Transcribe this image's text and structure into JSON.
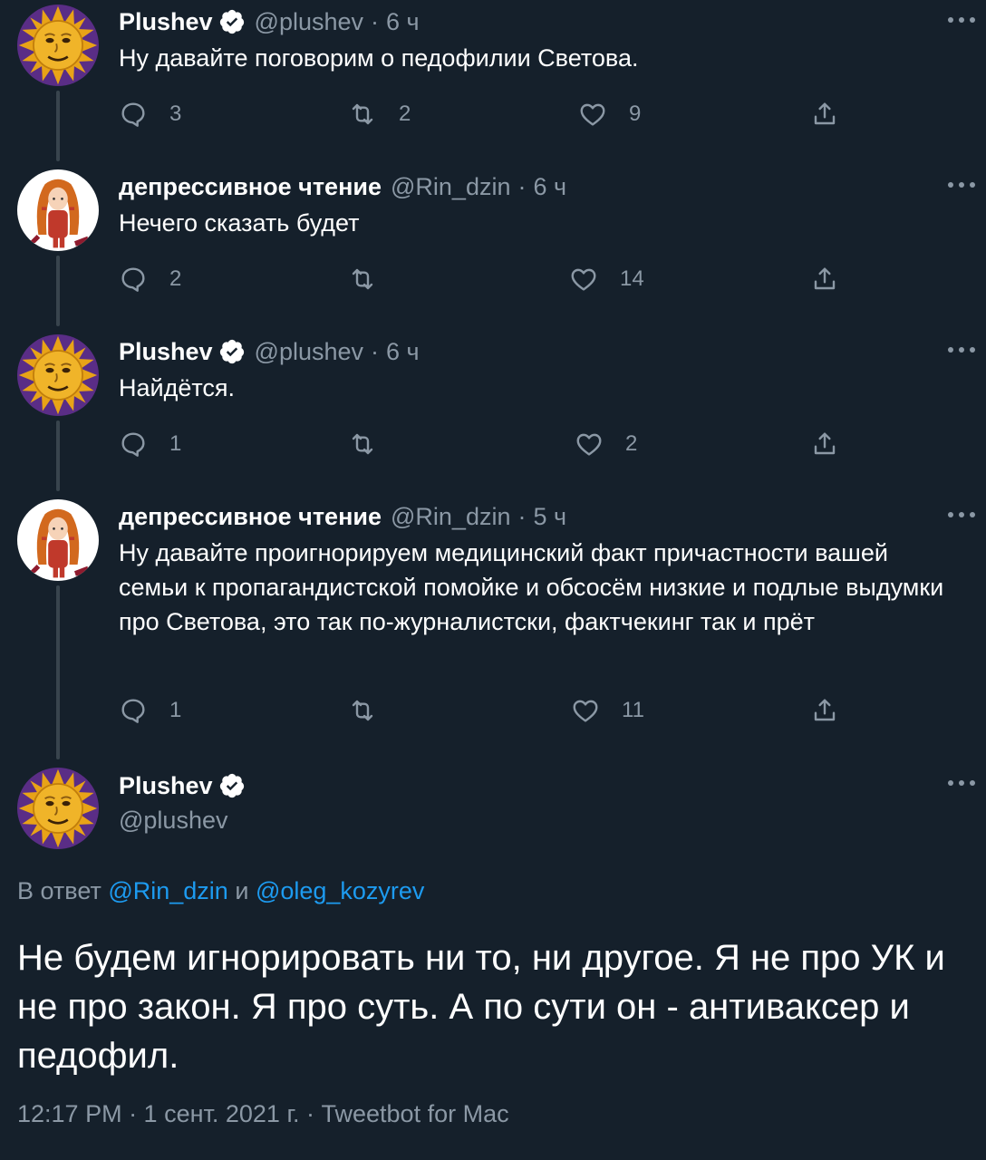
{
  "theme": {
    "background": "#15202b",
    "secondary_text": "#8b98a5",
    "link": "#1d9bf0",
    "thread_line": "#38444d"
  },
  "thread": [
    {
      "name": "Plushev",
      "verified": true,
      "handle": "@plushev",
      "time": "6 ч",
      "text": "Ну давайте поговорим о педофилии Светова.",
      "replies": "3",
      "retweets": "2",
      "likes": "9",
      "avatar": "sun-avatar"
    },
    {
      "name": "депрессивное чтение",
      "verified": false,
      "handle": "@Rin_dzin",
      "time": "6 ч",
      "text": "Нечего сказать будет",
      "replies": "2",
      "retweets": "",
      "likes": "14",
      "avatar": "anime-avatar"
    },
    {
      "name": "Plushev",
      "verified": true,
      "handle": "@plushev",
      "time": "6 ч",
      "text": "Найдётся.",
      "replies": "1",
      "retweets": "",
      "likes": "2",
      "avatar": "sun-avatar"
    },
    {
      "name": "депрессивное чтение",
      "verified": false,
      "handle": "@Rin_dzin",
      "time": "5 ч",
      "text": "Ну давайте проигнорируем медицинский факт причастности вашей семьи к пропагандистской помойке и обсосём низкие и подлые выдумки про Светова, это так по-журналистски, фактчекинг так и прёт",
      "replies": "1",
      "retweets": "",
      "likes": "11",
      "avatar": "anime-avatar"
    }
  ],
  "main": {
    "name": "Plushev",
    "verified": true,
    "handle": "@plushev",
    "avatar": "sun-avatar",
    "reply_prefix": "В ответ",
    "reply_user1": "@Rin_dzin",
    "reply_and": "и",
    "reply_user2": "@oleg_kozyrev",
    "text": "Не будем игнорировать ни то, ни другое. Я не про УК и не про закон. Я про суть. А по сути он - антиваксер и педофил.",
    "footer": "12:17 PM · 1 сент. 2021 г. · Tweetbot for Mac"
  },
  "icons": [
    "reply-icon",
    "retweet-icon",
    "like-icon",
    "share-icon",
    "more-icon",
    "verified-icon"
  ]
}
